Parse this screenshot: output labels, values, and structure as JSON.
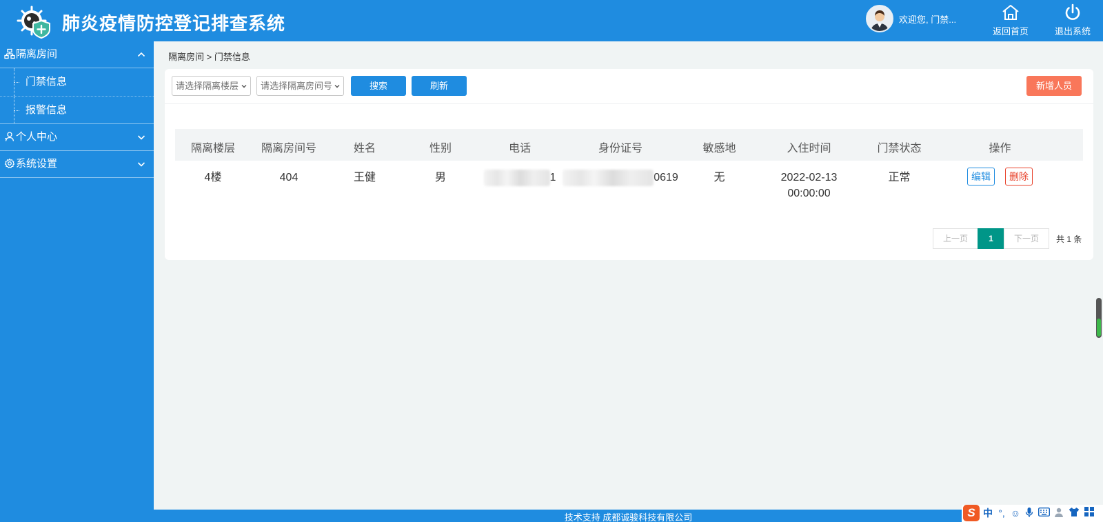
{
  "header": {
    "title": "肺炎疫情防控登记排查系统",
    "welcome": "欢迎您, 门禁...",
    "home_label": "返回首页",
    "exit_label": "退出系统"
  },
  "sidebar": {
    "groups": [
      {
        "label": "隔离房间",
        "expanded": true,
        "items": [
          {
            "label": "门禁信息"
          },
          {
            "label": "报警信息"
          }
        ]
      },
      {
        "label": "个人中心",
        "expanded": false
      },
      {
        "label": "系统设置",
        "expanded": false
      }
    ]
  },
  "breadcrumb": "隔离房间 > 门禁信息",
  "toolbar": {
    "floor_placeholder": "请选择隔离楼层",
    "room_placeholder": "请选择隔离房间号",
    "search_label": "搜索",
    "refresh_label": "刷新",
    "add_label": "新增人员"
  },
  "table": {
    "columns": [
      "隔离楼层",
      "隔离房间号",
      "姓名",
      "性别",
      "电话",
      "身份证号",
      "敏感地",
      "入住时间",
      "门禁状态",
      "操作"
    ],
    "rows": [
      {
        "floor": "4楼",
        "room": "404",
        "name": "王健",
        "gender": "男",
        "phone_visible": "1",
        "id_visible": "0619",
        "sensitive": "无",
        "checkin_date": "2022-02-13",
        "checkin_time": "00:00:00",
        "status": "正常",
        "edit_label": "编辑",
        "delete_label": "删除"
      }
    ]
  },
  "pagination": {
    "prev_label": "上一页",
    "current_page": "1",
    "next_label": "下一页",
    "total_text": "共 1 条"
  },
  "footer": {
    "text": "技术支持 成都诚骏科技有限公司"
  },
  "ime": {
    "logo": "S",
    "mode": "中"
  },
  "colors": {
    "primary": "#1f8ce0",
    "add_button": "#f9775a",
    "delete": "#e8412a",
    "page_active": "#009688"
  }
}
